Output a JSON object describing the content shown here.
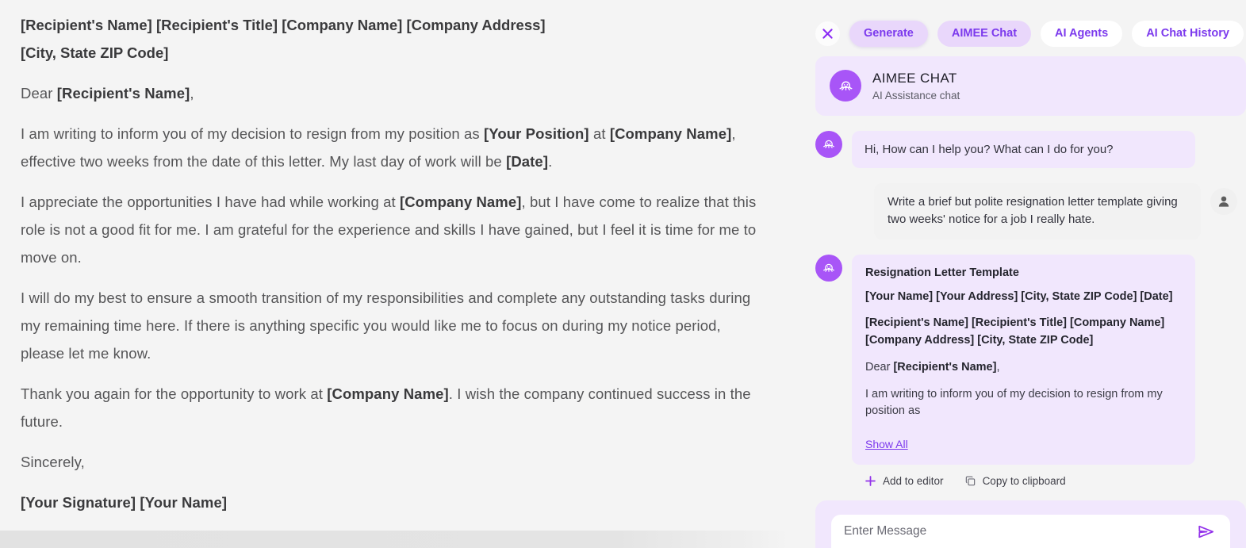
{
  "document": {
    "heading_lines": [
      "[Recipient's Name] [Recipient's Title] [Company Name] [Company Address]",
      "[City, State ZIP Code]"
    ],
    "salutation_prefix": "Dear ",
    "salutation_name": "[Recipient's Name]",
    "salutation_suffix": ",",
    "paragraph_1": {
      "t1": "I am writing to inform you of my decision to resign from my position as ",
      "b1": "[Your Position]",
      "t2": " at ",
      "b2": "[Company Name]",
      "t3": ", effective two weeks from the date of this letter. My last day of work will be ",
      "b3": "[Date]",
      "t4": "."
    },
    "paragraph_2": {
      "t1": "I appreciate the opportunities I have had while working at ",
      "b1": "[Company Name]",
      "t2": ", but I have come to realize that this role is not a good fit for me. I am grateful for the experience and skills I have gained, but I feel it is time for me to move on."
    },
    "paragraph_3": "I will do my best to ensure a smooth transition of my responsibilities and complete any outstanding tasks during my remaining time here. If there is anything specific you would like me to focus on during my notice period, please let me know.",
    "paragraph_4": {
      "t1": "Thank you again for the opportunity to work at ",
      "b1": "[Company Name]",
      "t2": ". I wish the company continued success in the future."
    },
    "closing": "Sincerely,",
    "signature": "[Your Signature] [Your Name]"
  },
  "chat": {
    "close_label": "close-icon",
    "tabs": [
      {
        "label": "Generate",
        "style": "filled-shadow"
      },
      {
        "label": "AIMEE Chat",
        "style": "filled"
      },
      {
        "label": "AI Agents",
        "style": "plain"
      },
      {
        "label": "AI Chat History",
        "style": "plain"
      }
    ],
    "header": {
      "title": "AIMEE CHAT",
      "subtitle": "AI Assistance chat",
      "avatar_icon": "octopus-icon"
    },
    "messages": [
      {
        "role": "assistant",
        "text": "Hi, How can I help you? What can I do for you?"
      },
      {
        "role": "user",
        "text": "Write a brief but polite resignation letter template giving two weeks' notice for a job I really hate."
      }
    ],
    "answer_card": {
      "title": "Resignation Letter Template",
      "line_1": "[Your Name] [Your Address] [City, State ZIP Code] [Date]",
      "line_2": "[Recipient's Name] [Recipient's Title] [Company Name] [Company Address] [City, State ZIP Code]",
      "salutation_prefix": "Dear ",
      "salutation_name": "[Recipient's Name]",
      "salutation_suffix": ",",
      "body": "I am writing to inform you of my decision to resign from my position as",
      "show_all_label": "Show All"
    },
    "actions": [
      {
        "label": "Add to editor",
        "icon": "plus-icon"
      },
      {
        "label": "Copy to clipboard",
        "icon": "copy-icon"
      }
    ],
    "composer": {
      "placeholder": "Enter Message",
      "value": "",
      "send_icon": "send-icon"
    }
  },
  "colors": {
    "accent_purple": "#7c3aed",
    "avatar_purple": "#a855f7",
    "bubble_lavender": "#f1e7fd",
    "tab_filled": "#e9d7fb",
    "scrollbar_thumb": "#9150f8",
    "page_bg": "#f4f4f4"
  }
}
